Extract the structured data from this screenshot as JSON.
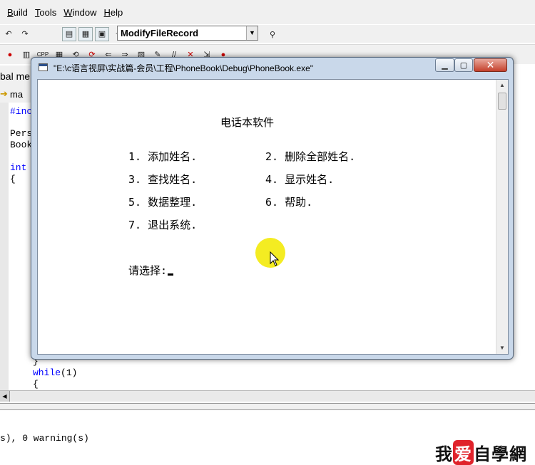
{
  "menu": {
    "items": [
      "Build",
      "Tools",
      "Window",
      "Help"
    ]
  },
  "toolbar": {
    "function_combo": "ModifyFileRecord"
  },
  "left_panel": {
    "workspace_tab": "bal me",
    "class_combo": "ma"
  },
  "code": {
    "lines_top": [
      "#inc",
      "Pers",
      "Book",
      "int",
      "{"
    ],
    "line_brace": "}",
    "line_while_kw": "while",
    "line_while_rest": "(1)",
    "line_open": "{"
  },
  "output": {
    "line": "s), 0 warning(s)"
  },
  "watermark": {
    "text_left": "我",
    "text_heart": "爱",
    "text_right": "自學網"
  },
  "console": {
    "title": "\"E:\\c语言视屏\\实战篇-会员\\工程\\PhoneBook\\Debug\\PhoneBook.exe\"",
    "app_title": "电话本软件",
    "menu_items": [
      "1. 添加姓名.",
      "2. 删除全部姓名.",
      "3. 查找姓名.",
      "4. 显示姓名.",
      "5. 数据整理.",
      "6. 帮助.",
      "7. 退出系统."
    ],
    "prompt": "请选择:"
  },
  "colors": {
    "highlight": "#f4ec22",
    "close_button": "#c4402b",
    "keyword": "#0000ff"
  }
}
